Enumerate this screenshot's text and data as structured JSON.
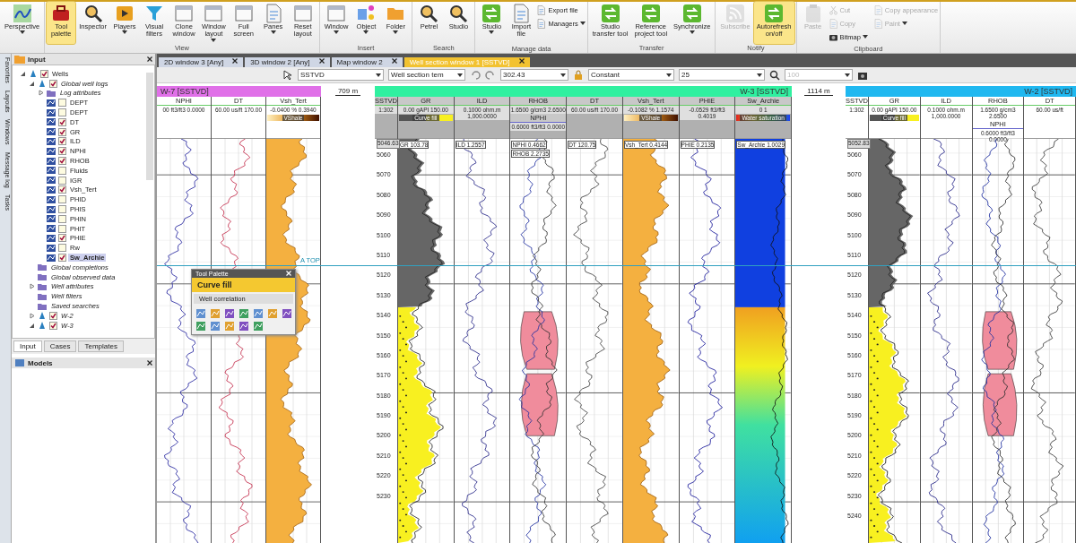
{
  "ribbon": {
    "groups": [
      {
        "buttons": [
          {
            "label": "Perspective",
            "kind": "large",
            "active": false,
            "disabled": false,
            "dropdown": true
          }
        ]
      },
      {
        "label": "View",
        "buttons": [
          {
            "label": "Tool\npalette",
            "kind": "large",
            "active": true,
            "disabled": false,
            "dropdown": false
          },
          {
            "label": "Inspector",
            "kind": "large",
            "active": false,
            "disabled": false,
            "dropdown": false
          },
          {
            "label": "Players",
            "kind": "large",
            "active": false,
            "disabled": false,
            "dropdown": true
          },
          {
            "label": "Visual\nfilters",
            "kind": "large",
            "active": false,
            "disabled": false,
            "dropdown": false
          },
          {
            "label": "Clone\nwindow",
            "kind": "large",
            "active": false,
            "disabled": false,
            "dropdown": false
          },
          {
            "label": "Window\nlayout",
            "kind": "large",
            "active": false,
            "disabled": false,
            "dropdown": true
          },
          {
            "label": "Full\nscreen",
            "kind": "large",
            "active": false,
            "disabled": false,
            "dropdown": false
          },
          {
            "label": "Panes",
            "kind": "large",
            "active": false,
            "disabled": false,
            "dropdown": true
          },
          {
            "label": "Reset\nlayout",
            "kind": "large",
            "active": false,
            "disabled": false,
            "dropdown": false
          }
        ]
      },
      {
        "label": "Insert",
        "buttons": [
          {
            "label": "Window",
            "kind": "large",
            "active": false,
            "disabled": false,
            "dropdown": true
          },
          {
            "label": "Object",
            "kind": "large",
            "active": false,
            "disabled": false,
            "dropdown": true
          },
          {
            "label": "Folder",
            "kind": "large",
            "active": false,
            "disabled": false,
            "dropdown": true
          }
        ]
      },
      {
        "label": "Search",
        "buttons": [
          {
            "label": "Petrel",
            "kind": "large",
            "active": false,
            "disabled": false,
            "dropdown": false
          },
          {
            "label": "Studio",
            "kind": "large",
            "active": false,
            "disabled": false,
            "dropdown": false
          }
        ]
      },
      {
        "label": "Manage data",
        "buttons": [
          {
            "label": "Studio",
            "kind": "large",
            "active": false,
            "disabled": false,
            "dropdown": true
          },
          {
            "label": "Import\nfile",
            "kind": "large",
            "active": false,
            "disabled": false,
            "dropdown": false
          },
          {
            "label": "Export file",
            "kind": "small",
            "active": false,
            "disabled": false,
            "dropdown": false
          },
          {
            "label": "Managers",
            "kind": "small",
            "active": false,
            "disabled": false,
            "dropdown": true
          }
        ]
      },
      {
        "label": "Transfer",
        "buttons": [
          {
            "label": "Studio\ntransfer tool",
            "kind": "large",
            "active": false,
            "disabled": false,
            "dropdown": false
          },
          {
            "label": "Reference\nproject tool",
            "kind": "large",
            "active": false,
            "disabled": false,
            "dropdown": false
          },
          {
            "label": "Synchronize",
            "kind": "large",
            "active": false,
            "disabled": false,
            "dropdown": true
          }
        ]
      },
      {
        "label": "Notify",
        "buttons": [
          {
            "label": "Subscribe",
            "kind": "large",
            "active": false,
            "disabled": true,
            "dropdown": false
          },
          {
            "label": "Autorefresh\non/off",
            "kind": "large",
            "active": true,
            "disabled": false,
            "dropdown": false
          }
        ]
      },
      {
        "label": "Clipboard",
        "buttons": [
          {
            "label": "Paste",
            "kind": "large",
            "active": false,
            "disabled": true,
            "dropdown": false
          },
          {
            "label": "Cut",
            "kind": "small",
            "active": false,
            "disabled": true,
            "dropdown": false
          },
          {
            "label": "Copy",
            "kind": "small",
            "active": false,
            "disabled": true,
            "dropdown": false
          },
          {
            "label": "Bitmap",
            "kind": "small",
            "active": false,
            "disabled": false,
            "dropdown": true
          },
          {
            "label": "Copy appearance",
            "kind": "small",
            "active": false,
            "disabled": true,
            "dropdown": false
          },
          {
            "label": "Paint",
            "kind": "small",
            "active": false,
            "disabled": true,
            "dropdown": true
          }
        ]
      }
    ]
  },
  "side_tabs": [
    "Favorites",
    "Layouts",
    "Windows",
    "Message log",
    "Tasks"
  ],
  "input_panel": {
    "title": "Input",
    "tree": [
      {
        "label": "Wells",
        "kind": "group",
        "checked": true,
        "expanded": true,
        "selected": false,
        "children": [
          {
            "label": "Global well logs",
            "kind": "group",
            "checked": true,
            "expanded": true,
            "selected": false,
            "children": [
              {
                "label": "Log attributes",
                "kind": "folder",
                "expanded": false,
                "selected": false
              },
              {
                "label": "DEPT",
                "kind": "log",
                "checked": false,
                "selected": false
              },
              {
                "label": "DEPT",
                "kind": "log",
                "checked": false,
                "selected": false
              },
              {
                "label": "DT",
                "kind": "log",
                "checked": true,
                "selected": false
              },
              {
                "label": "GR",
                "kind": "log",
                "checked": true,
                "selected": false
              },
              {
                "label": "ILD",
                "kind": "log",
                "checked": true,
                "selected": false
              },
              {
                "label": "NPHI",
                "kind": "log",
                "checked": true,
                "selected": false
              },
              {
                "label": "RHOB",
                "kind": "log",
                "checked": true,
                "selected": false
              },
              {
                "label": "Fluids",
                "kind": "log",
                "checked": false,
                "selected": false
              },
              {
                "label": "IGR",
                "kind": "log",
                "checked": false,
                "selected": false
              },
              {
                "label": "Vsh_Tert",
                "kind": "log",
                "checked": true,
                "selected": false
              },
              {
                "label": "PHID",
                "kind": "log",
                "checked": false,
                "selected": false
              },
              {
                "label": "PHIS",
                "kind": "log",
                "checked": false,
                "selected": false
              },
              {
                "label": "PHIN",
                "kind": "log",
                "checked": false,
                "selected": false
              },
              {
                "label": "PHIT",
                "kind": "log",
                "checked": false,
                "selected": false
              },
              {
                "label": "PHIE",
                "kind": "log",
                "checked": true,
                "selected": false
              },
              {
                "label": "Rw",
                "kind": "log",
                "checked": false,
                "selected": false
              },
              {
                "label": "Sw_Archie",
                "kind": "log",
                "checked": true,
                "selected": true
              }
            ]
          },
          {
            "label": "Global completions",
            "kind": "folder",
            "selected": false
          },
          {
            "label": "Global observed data",
            "kind": "folder",
            "selected": false
          },
          {
            "label": "Well attributes",
            "kind": "folder",
            "expanded": false,
            "selected": false
          },
          {
            "label": "Well filters",
            "kind": "folder",
            "selected": false
          },
          {
            "label": "Saved searches",
            "kind": "folder",
            "selected": false
          },
          {
            "label": "W-2",
            "kind": "group",
            "checked": true,
            "expanded": false,
            "selected": false
          },
          {
            "label": "W-3",
            "kind": "group",
            "checked": true,
            "expanded": true,
            "selected": false
          }
        ]
      }
    ],
    "tabs": [
      {
        "label": "Input",
        "selected": true
      },
      {
        "label": "Cases",
        "selected": false
      },
      {
        "label": "Templates",
        "selected": false
      }
    ]
  },
  "models_panel": {
    "title": "Models"
  },
  "window_tabs": [
    {
      "label": "2D window 3 [Any]",
      "selected": false
    },
    {
      "label": "3D window 2 [Any]",
      "selected": false
    },
    {
      "label": "Map window 2",
      "selected": false
    },
    {
      "label": "Well section window 1 [SSTVD]",
      "selected": true
    }
  ],
  "toolbar": {
    "domain": "SSTVD",
    "template": "Well section tem",
    "scale": "302.43",
    "mode": "Constant",
    "spacing": "25",
    "zoom": "100"
  },
  "tool_palette": {
    "title": "Tool Palette",
    "current": "Curve fill",
    "section": "Well correlation"
  },
  "marker": {
    "label": "A TOP"
  },
  "distances": [
    "709 m",
    "1114 m"
  ],
  "wells": [
    {
      "name": "W-7 [SSTVD]",
      "color": "#e070e8",
      "selected": false,
      "tracks": [
        {
          "kind": "log",
          "name": "NPHI",
          "scale": [
            "00 ft3/ft3",
            "0.0000"
          ]
        },
        {
          "kind": "log",
          "name": "DT",
          "scale": [
            "60.00",
            "us/ft",
            "170.00"
          ]
        },
        {
          "kind": "log",
          "name": "Vsh_Tert",
          "scale": [
            "-0.0400",
            "%",
            "0.3940"
          ],
          "legend": {
            "label": "VShale",
            "kind": "vshale"
          }
        }
      ]
    },
    {
      "name": "W-3 [SSTVD]",
      "color": "#30f0a0",
      "selected": true,
      "tracks": [
        {
          "kind": "depth",
          "name": "SSTVD",
          "scale": [
            "1:302"
          ],
          "readouts": [
            "5046.63"
          ],
          "depths": [
            "5060",
            "5070",
            "5080",
            "5090",
            "5100",
            "5110",
            "5120",
            "5130",
            "5140",
            "5150",
            "5160",
            "5170",
            "5180",
            "5190",
            "5200",
            "5210",
            "5220",
            "5230"
          ]
        },
        {
          "kind": "log",
          "name": "GR",
          "scale": [
            "0.00",
            "gAPI",
            "150.00"
          ],
          "legend": {
            "label": "Curve fill",
            "kind": "curvefill"
          },
          "readouts": [
            "GR 103.78"
          ]
        },
        {
          "kind": "log",
          "name": "ILD",
          "scale": [
            "0.1000 ohm.m",
            "1,000.0000"
          ],
          "readouts": [
            "ILD 1.2557"
          ]
        },
        {
          "kind": "log",
          "name": "RHOB",
          "scale": [
            "1.6500 g/cm3",
            "2.6500"
          ],
          "second": {
            "name": "NPHI",
            "scale": [
              "0.6000 ft3/ft3",
              "0.0000"
            ]
          },
          "readouts": [
            "NPHI 0.4662",
            "RHOB 2.2735"
          ]
        },
        {
          "kind": "log",
          "name": "DT",
          "scale": [
            "60.00",
            "us/ft",
            "170.00"
          ],
          "readouts": [
            "DT 120.75"
          ]
        },
        {
          "kind": "log",
          "name": "Vsh_Tert",
          "scale": [
            "-0.1082",
            "%",
            "1.1574"
          ],
          "legend": {
            "label": "VShale",
            "kind": "vshale"
          },
          "readouts": [
            "Vsh_Tert 0.4144"
          ]
        },
        {
          "kind": "log",
          "name": "PHIE",
          "scale": [
            "-0.0529 ft3/ft3",
            "0.4019"
          ],
          "readouts": [
            "PHIE 0.2135"
          ]
        },
        {
          "kind": "log",
          "name": "Sw_Archie",
          "scale": [
            "0",
            "1"
          ],
          "legend": {
            "label": "Water saturation",
            "kind": "saturation"
          },
          "readouts": [
            "Sw_Archie 1.0029"
          ]
        }
      ]
    },
    {
      "name": "W-2 [SSTVD]",
      "color": "#20b8f0",
      "selected": false,
      "tracks": [
        {
          "kind": "depth",
          "name": "SSTVD",
          "scale": [
            "1:302"
          ],
          "readouts": [
            "5052.83"
          ],
          "depths": [
            "5060",
            "5070",
            "5080",
            "5090",
            "5100",
            "5110",
            "5120",
            "5130",
            "5140",
            "5150",
            "5160",
            "5170",
            "5180",
            "5190",
            "5200",
            "5210",
            "5220",
            "5230",
            "5240"
          ]
        },
        {
          "kind": "log",
          "name": "GR",
          "scale": [
            "0.00",
            "gAPI",
            "150.00"
          ],
          "legend": {
            "label": "Curve fill",
            "kind": "curvefill"
          }
        },
        {
          "kind": "log",
          "name": "ILD",
          "scale": [
            "0.1000 ohm.m",
            "1,000.0000"
          ]
        },
        {
          "kind": "log",
          "name": "RHOB",
          "scale": [
            "1.6500 g/cm3",
            "2.6500"
          ],
          "second": {
            "name": "NPHI",
            "scale": [
              "0.6000 ft3/ft3",
              "0.0000"
            ]
          }
        },
        {
          "kind": "log",
          "name": "DT",
          "scale": [
            "60.00",
            "us/ft"
          ]
        }
      ]
    }
  ]
}
